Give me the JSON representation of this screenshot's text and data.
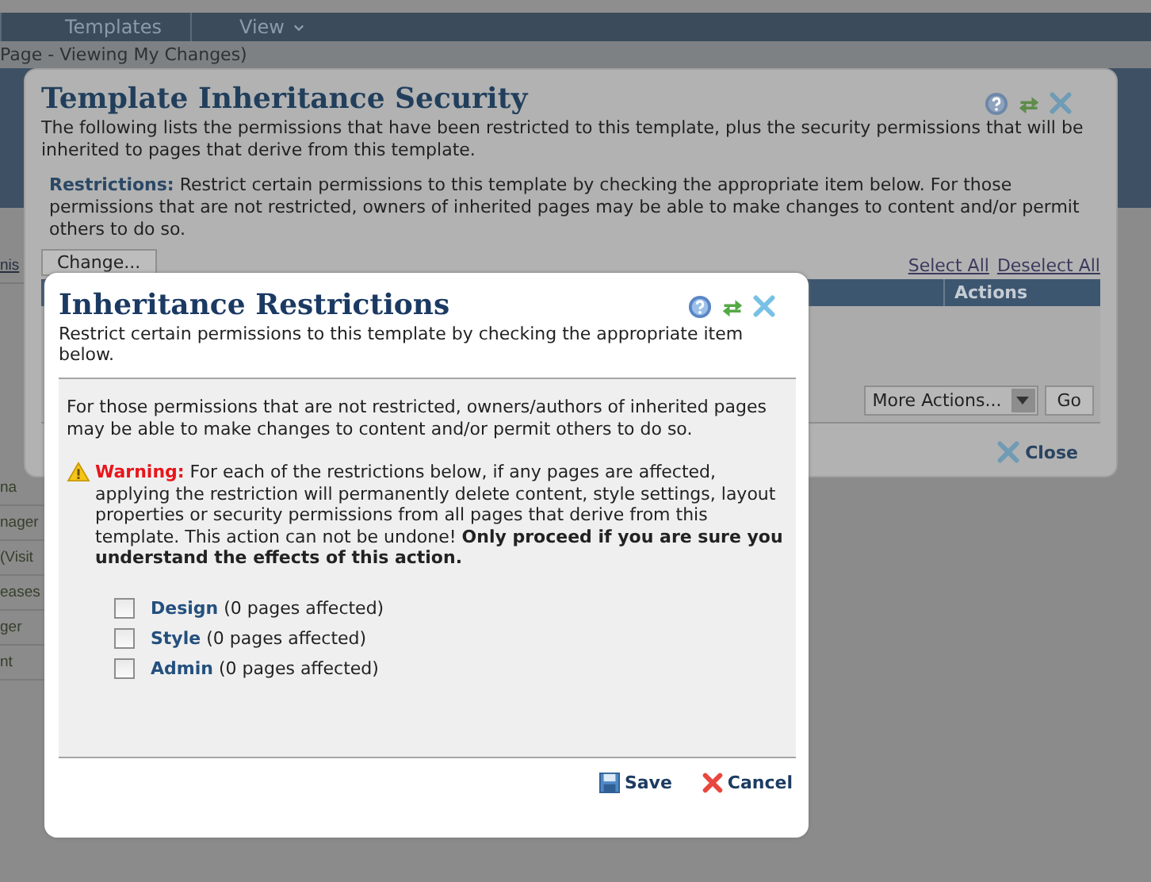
{
  "background_page": {
    "nav_tabs": [
      {
        "label": "Templates",
        "dropdown": false
      },
      {
        "label": "View",
        "dropdown": true
      }
    ],
    "breadcrumb": "Page - Viewing My Changes)",
    "sidebar_fragments": [
      "nis",
      "na",
      "nager",
      "(Visit",
      "eases",
      "ger",
      "nt"
    ]
  },
  "security_dialog": {
    "title": "Template Inheritance Security",
    "description": "The following lists the permissions that have been restricted to this template, plus the security permissions that will be inherited to pages that derive from this template.",
    "restrictions": "**Restrictions:** Restrict certain permissions to this template by checking the appropriate item below. For those permissions that are not restricted, owners of inherited pages may be able to make changes to content and/or permit others to do so.",
    "change_button": "Change...",
    "links": [
      "Select All",
      "Deselect All"
    ],
    "table": {
      "columns": [
        "Actions"
      ]
    },
    "more_actions": {
      "value": "More Actions..."
    },
    "go_button": "Go",
    "close_button": "Close"
  },
  "restrictions_dialog": {
    "title": "Inheritance Restrictions",
    "subtitle": "Restrict certain permissions to this template by checking the appropriate item below.",
    "intro": "For those permissions that are not restricted, owners/authors of inherited pages may be able to make changes to content and/or permit others to do so.",
    "warning": {
      "text": "**Warning:** For each of the restrictions below, if any pages are affected, applying the restriction will permanently delete content, style settings, layout properties or security permissions from all pages that derive from this template. This action can not be undone! **Only proceed if you are sure you understand the effects of this action.**"
    },
    "options": [
      {
        "name": "Design",
        "note": "(0 pages affected)",
        "checked": false
      },
      {
        "name": "Style",
        "note": "(0 pages affected)",
        "checked": false
      },
      {
        "name": "Admin",
        "note": "(0 pages affected)",
        "checked": false
      }
    ],
    "buttons": [
      {
        "kind": "save",
        "label": "Save"
      },
      {
        "kind": "cancel",
        "label": "Cancel"
      }
    ]
  }
}
